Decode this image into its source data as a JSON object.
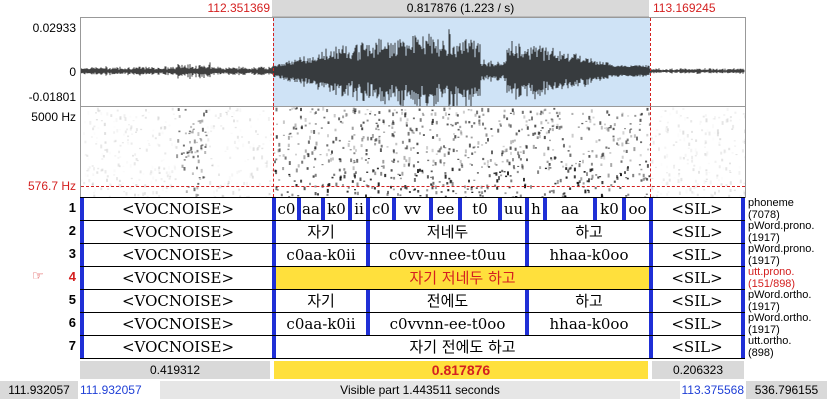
{
  "top_bar": {
    "left_time": "112.351369",
    "selection_label": "0.817876 (1.223 / s)",
    "right_time": "113.169245"
  },
  "waveform": {
    "max_label": "0.02933",
    "zero_label": "0",
    "min_label": "-0.01801"
  },
  "spectrogram": {
    "max_freq": "5000 Hz",
    "cursor_freq": "576.7 Hz"
  },
  "tiers": [
    {
      "number": "1",
      "pointer": "",
      "name": "phoneme",
      "count": "(7078)",
      "segments": [
        "<VOCNOISE>",
        "c0",
        "aa",
        "k0",
        "ii",
        "c0",
        "vv",
        "ee",
        "t0",
        "uu",
        "h",
        "aa",
        "k0",
        "oo",
        "<SIL>"
      ]
    },
    {
      "number": "2",
      "pointer": "",
      "name": "pWord.prono.",
      "count": "(1917)",
      "segments": [
        "<VOCNOISE>",
        "자기",
        "저네두",
        "하고",
        "<SIL>"
      ]
    },
    {
      "number": "3",
      "pointer": "",
      "name": "pWord.prono.",
      "count": "(1917)",
      "segments": [
        "<VOCNOISE>",
        "c0aa-k0ii",
        "c0vv-nnee-t0uu",
        "hhaa-k0oo",
        "<SIL>"
      ]
    },
    {
      "number": "4",
      "pointer": "☞",
      "name": "utt.prono.",
      "count": "(151/898)",
      "segments": [
        "<VOCNOISE>",
        "자기 저네두 하고",
        "<SIL>"
      ]
    },
    {
      "number": "5",
      "pointer": "",
      "name": "pWord.ortho.",
      "count": "(1917)",
      "segments": [
        "<VOCNOISE>",
        "자기",
        "전에도",
        "하고",
        "<SIL>"
      ]
    },
    {
      "number": "6",
      "pointer": "",
      "name": "pWord.ortho.",
      "count": "(1917)",
      "segments": [
        "<VOCNOISE>",
        "c0aa-k0ii",
        "c0vvnn-ee-t0oo",
        "hhaa-k0oo",
        "<SIL>"
      ]
    },
    {
      "number": "7",
      "pointer": "",
      "name": "utt.ortho.",
      "count": "(898)",
      "segments": [
        "<VOCNOISE>",
        "자기 전에도 하고",
        "<SIL>"
      ]
    }
  ],
  "durations": {
    "left": "0.419312",
    "selection": "0.817876",
    "right": "0.206323"
  },
  "bottom_bar": {
    "window_start": "111.932057",
    "visible_start": "111.932057",
    "visible_label": "Visible part 1.443511 seconds",
    "visible_end": "113.375568",
    "window_end": "536.796155"
  },
  "colors": {
    "selection_shade": "#cfe3f6",
    "selection_highlight": "#ffe03c",
    "boundary": "#1f2fd6",
    "time_red": "#d42020",
    "time_blue": "#1f3fd6"
  }
}
